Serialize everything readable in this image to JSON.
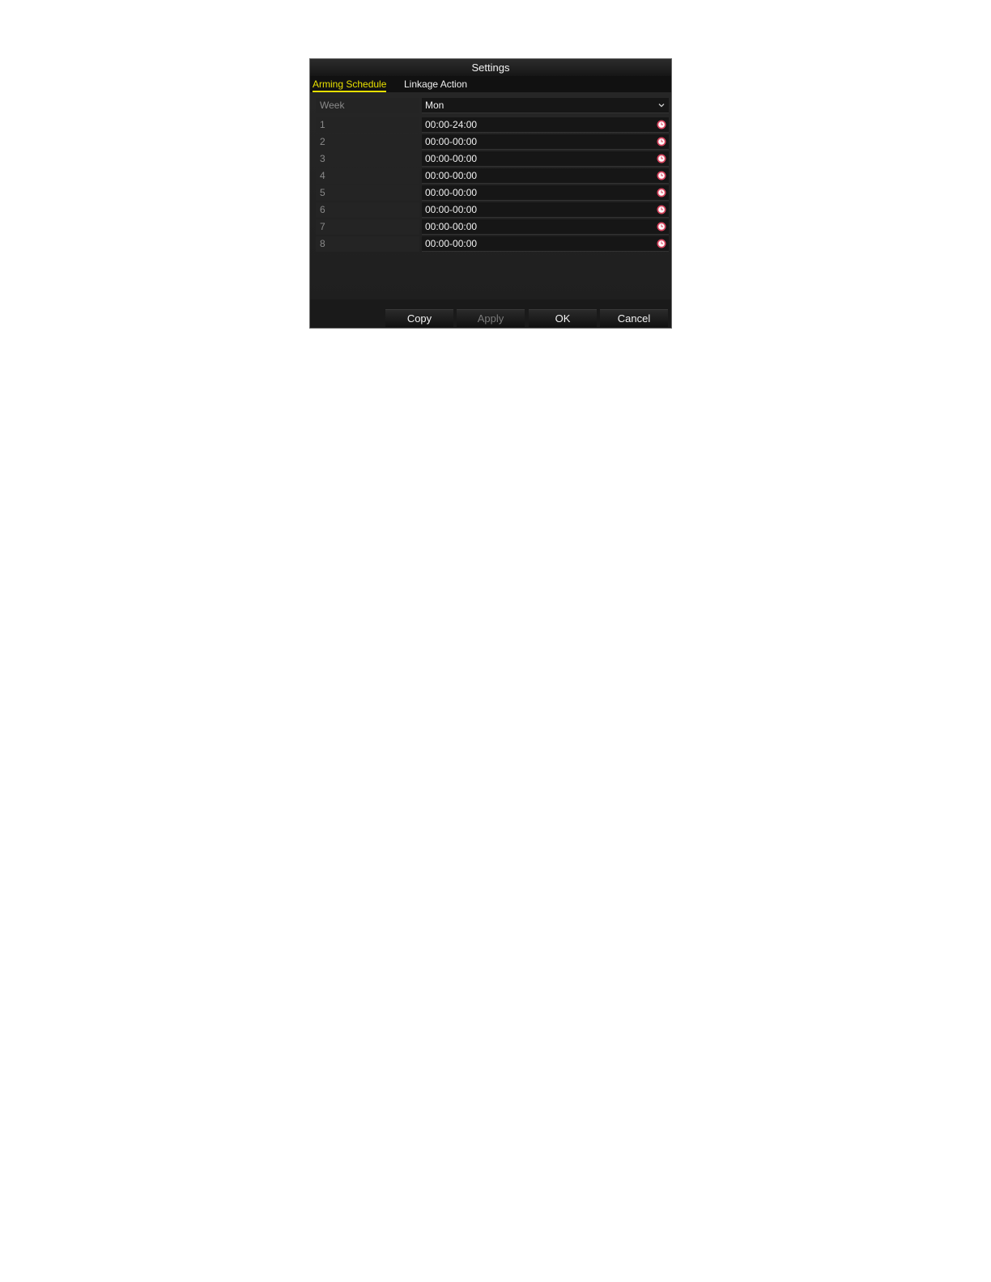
{
  "dialog": {
    "title": "Settings",
    "tabs": [
      {
        "label": "Arming Schedule",
        "active": true
      },
      {
        "label": "Linkage Action",
        "active": false
      }
    ],
    "week": {
      "label": "Week",
      "value": "Mon"
    },
    "periods": [
      {
        "index": "1",
        "time": "00:00-24:00"
      },
      {
        "index": "2",
        "time": "00:00-00:00"
      },
      {
        "index": "3",
        "time": "00:00-00:00"
      },
      {
        "index": "4",
        "time": "00:00-00:00"
      },
      {
        "index": "5",
        "time": "00:00-00:00"
      },
      {
        "index": "6",
        "time": "00:00-00:00"
      },
      {
        "index": "7",
        "time": "00:00-00:00"
      },
      {
        "index": "8",
        "time": "00:00-00:00"
      }
    ],
    "buttons": {
      "copy": "Copy",
      "apply": "Apply",
      "ok": "OK",
      "cancel": "Cancel"
    }
  },
  "colors": {
    "active_tab": "#e8e000",
    "clock_icon": "#d9455f"
  }
}
